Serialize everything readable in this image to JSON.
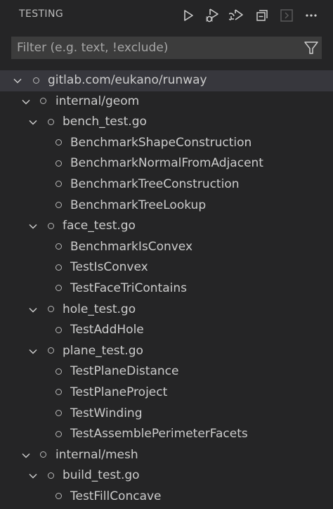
{
  "header": {
    "title": "TESTING"
  },
  "toolbar": {
    "run_all": "run-all-icon",
    "debug_all": "debug-all-icon",
    "rerun": "rerun-icon",
    "collapse_all": "collapse-all-icon",
    "show_output": "show-output-icon",
    "more": "more-actions-icon"
  },
  "filter": {
    "placeholder": "Filter (e.g. text, !exclude)",
    "value": ""
  },
  "tree": [
    {
      "label": "gitlab.com/eukano/runway",
      "depth": 0,
      "expandable": true,
      "selected": true
    },
    {
      "label": "internal/geom",
      "depth": 1,
      "expandable": true
    },
    {
      "label": "bench_test.go",
      "depth": 2,
      "expandable": true
    },
    {
      "label": "BenchmarkShapeConstruction",
      "depth": 3,
      "expandable": false
    },
    {
      "label": "BenchmarkNormalFromAdjacent",
      "depth": 3,
      "expandable": false
    },
    {
      "label": "BenchmarkTreeConstruction",
      "depth": 3,
      "expandable": false
    },
    {
      "label": "BenchmarkTreeLookup",
      "depth": 3,
      "expandable": false
    },
    {
      "label": "face_test.go",
      "depth": 2,
      "expandable": true
    },
    {
      "label": "BenchmarkIsConvex",
      "depth": 3,
      "expandable": false
    },
    {
      "label": "TestIsConvex",
      "depth": 3,
      "expandable": false
    },
    {
      "label": "TestFaceTriContains",
      "depth": 3,
      "expandable": false
    },
    {
      "label": "hole_test.go",
      "depth": 2,
      "expandable": true
    },
    {
      "label": "TestAddHole",
      "depth": 3,
      "expandable": false
    },
    {
      "label": "plane_test.go",
      "depth": 2,
      "expandable": true
    },
    {
      "label": "TestPlaneDistance",
      "depth": 3,
      "expandable": false
    },
    {
      "label": "TestPlaneProject",
      "depth": 3,
      "expandable": false
    },
    {
      "label": "TestWinding",
      "depth": 3,
      "expandable": false
    },
    {
      "label": "TestAssemblePerimeterFacets",
      "depth": 3,
      "expandable": false
    },
    {
      "label": "internal/mesh",
      "depth": 1,
      "expandable": true
    },
    {
      "label": "build_test.go",
      "depth": 2,
      "expandable": true
    },
    {
      "label": "TestFillConcave",
      "depth": 3,
      "expandable": false
    }
  ]
}
